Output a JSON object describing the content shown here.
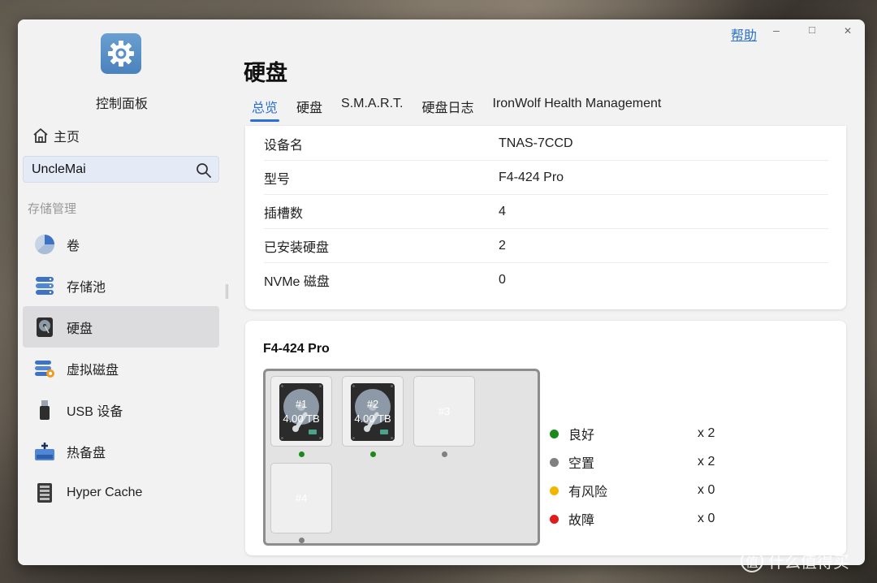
{
  "window": {
    "help_label": "帮助",
    "minimize": "–",
    "maximize": "□",
    "close": "✕"
  },
  "sidebar": {
    "app_title": "控制面板",
    "home_label": "主页",
    "search_value": "UncleMai",
    "section_title": "存储管理",
    "items": [
      {
        "label": "卷",
        "icon": "pie-chart-icon",
        "active": false
      },
      {
        "label": "存储池",
        "icon": "database-icon",
        "active": false
      },
      {
        "label": "硬盘",
        "icon": "hard-disk-icon",
        "active": true
      },
      {
        "label": "虚拟磁盘",
        "icon": "virtual-disk-icon",
        "active": false
      },
      {
        "label": "USB 设备",
        "icon": "usb-icon",
        "active": false
      },
      {
        "label": "热备盘",
        "icon": "hot-spare-icon",
        "active": false
      },
      {
        "label": "Hyper Cache",
        "icon": "ssd-icon",
        "active": false
      }
    ]
  },
  "main": {
    "title": "硬盘",
    "tabs": [
      {
        "label": "总览",
        "active": true
      },
      {
        "label": "硬盘",
        "active": false
      },
      {
        "label": "S.M.A.R.T.",
        "active": false
      },
      {
        "label": "硬盘日志",
        "active": false
      },
      {
        "label": "IronWolf Health Management",
        "active": false
      }
    ],
    "info": [
      {
        "key": "设备名",
        "value": "TNAS-7CCD"
      },
      {
        "key": "型号",
        "value": "F4-424 Pro"
      },
      {
        "key": "插槽数",
        "value": "4"
      },
      {
        "key": "已安装硬盘",
        "value": "2"
      },
      {
        "key": "NVMe 磁盘",
        "value": "0"
      }
    ],
    "enclosure": {
      "model": "F4-424 Pro",
      "bays": [
        {
          "num": "#1",
          "size": "4.00 TB",
          "installed": true,
          "status": "good"
        },
        {
          "num": "#2",
          "size": "4.00 TB",
          "installed": true,
          "status": "good"
        },
        {
          "num": "#3",
          "size": "",
          "installed": false,
          "status": "empty"
        },
        {
          "num": "#4",
          "size": "",
          "installed": false,
          "status": "empty"
        }
      ]
    },
    "legend": [
      {
        "label": "良好",
        "count": "x 2",
        "color": "#1a8a1a"
      },
      {
        "label": "空置",
        "count": "x 2",
        "color": "#808080"
      },
      {
        "label": "有风险",
        "count": "x 0",
        "color": "#f2b600"
      },
      {
        "label": "故障",
        "count": "x 0",
        "color": "#e01b1b"
      }
    ]
  },
  "watermark": "什么值得买",
  "colors": {
    "accent": "#2a6fd6",
    "good": "#1a8a1a",
    "empty": "#808080"
  }
}
